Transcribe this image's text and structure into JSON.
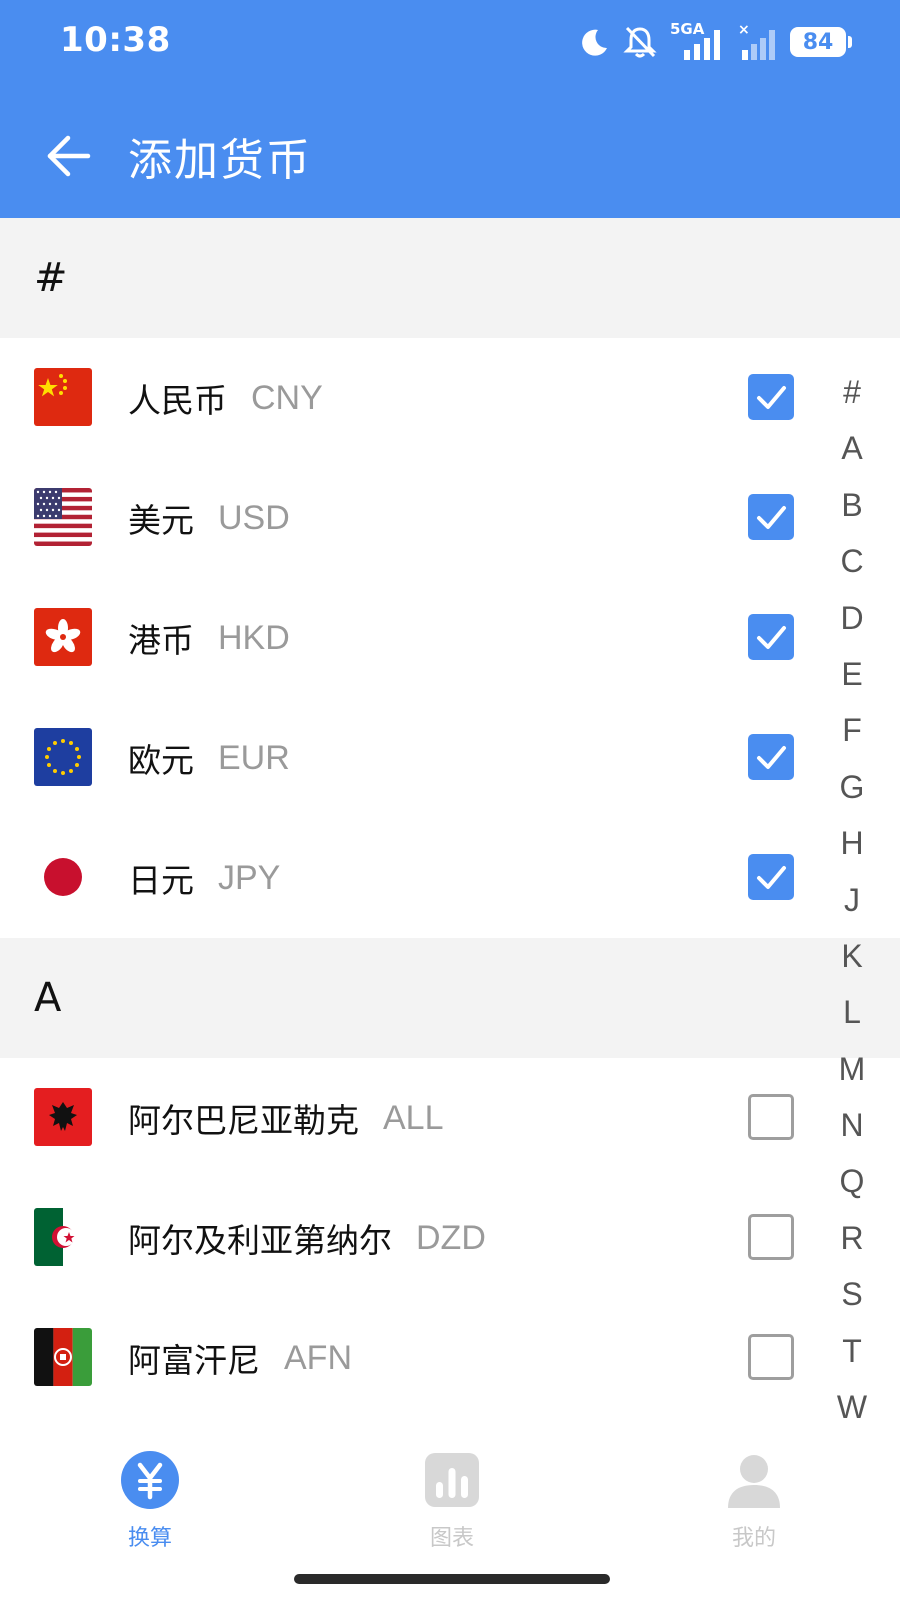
{
  "status_bar": {
    "time": "10:38",
    "network": "5GA",
    "battery": "84"
  },
  "toolbar": {
    "title": "添加货币"
  },
  "colors": {
    "primary": "#4a8df0",
    "section_bg": "#f3f3f3",
    "code_text": "#9a9a9a"
  },
  "sections": [
    {
      "header": "#",
      "items": [
        {
          "name": "人民币",
          "code": "CNY",
          "flag": "china-flag-icon",
          "checked": true
        },
        {
          "name": "美元",
          "code": "USD",
          "flag": "usa-flag-icon",
          "checked": true
        },
        {
          "name": "港币",
          "code": "HKD",
          "flag": "hong-kong-flag-icon",
          "checked": true
        },
        {
          "name": "欧元",
          "code": "EUR",
          "flag": "eu-flag-icon",
          "checked": true
        },
        {
          "name": "日元",
          "code": "JPY",
          "flag": "japan-flag-icon",
          "checked": true
        }
      ]
    },
    {
      "header": "A",
      "items": [
        {
          "name": "阿尔巴尼亚勒克",
          "code": "ALL",
          "flag": "albania-flag-icon",
          "checked": false
        },
        {
          "name": "阿尔及利亚第纳尔",
          "code": "DZD",
          "flag": "algeria-flag-icon",
          "checked": false
        },
        {
          "name": "阿富汗尼",
          "code": "AFN",
          "flag": "afghanistan-flag-icon",
          "checked": false
        }
      ]
    }
  ],
  "index_letters": [
    "#",
    "A",
    "B",
    "C",
    "D",
    "E",
    "F",
    "G",
    "H",
    "J",
    "K",
    "L",
    "M",
    "N",
    "Q",
    "R",
    "S",
    "T",
    "W"
  ],
  "bottom_nav": [
    {
      "label": "换算",
      "icon": "yen-circle-icon",
      "active": true
    },
    {
      "label": "图表",
      "icon": "bar-chart-icon",
      "active": false
    },
    {
      "label": "我的",
      "icon": "person-icon",
      "active": false
    }
  ]
}
